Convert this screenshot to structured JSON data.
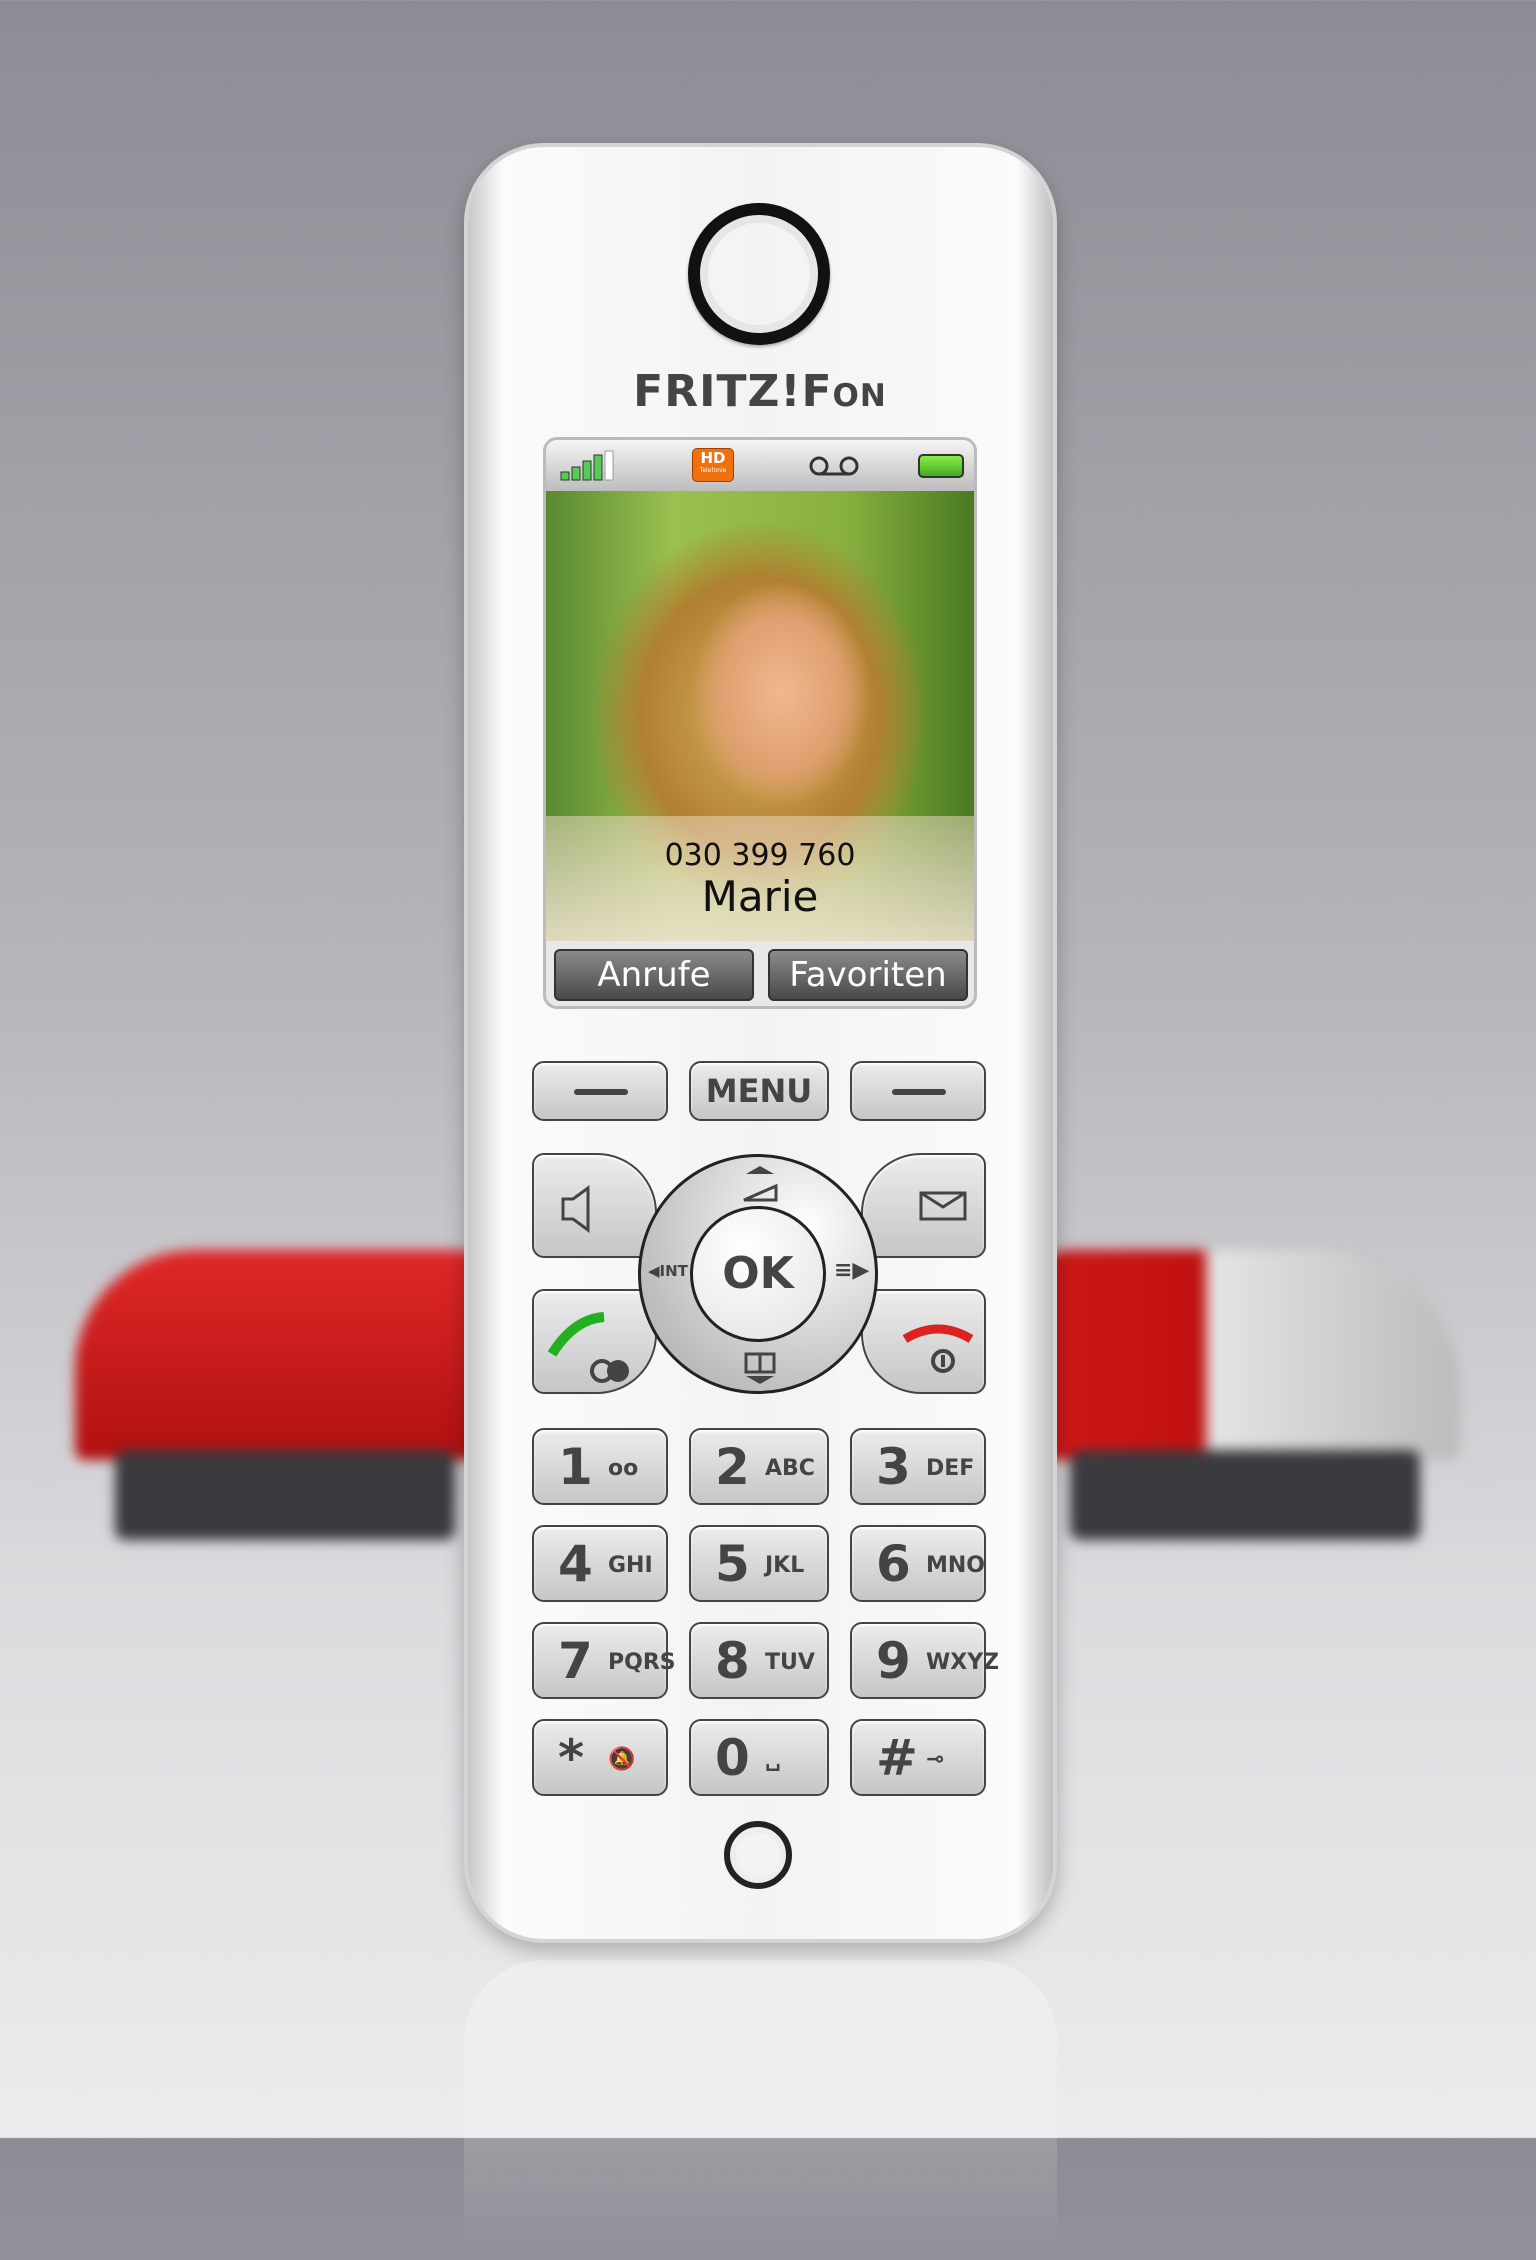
{
  "brand": {
    "logo": "FRITZ!Fon"
  },
  "status_bar": {
    "signal": "signal-strength-icon",
    "hd": "HD",
    "hd_sub": "Telefonie",
    "voicemail": "voicemail-icon",
    "battery": "battery-icon",
    "battery_level": 1.0
  },
  "contact": {
    "number": "030 399 760",
    "name": "Marie"
  },
  "softkeys": {
    "left": "Anrufe",
    "right": "Favoriten"
  },
  "controls": {
    "menu": "MENU",
    "ok": "OK",
    "int": "INT"
  },
  "keypad": [
    {
      "digit": "1",
      "letters": "oo"
    },
    {
      "digit": "2",
      "letters": "ABC"
    },
    {
      "digit": "3",
      "letters": "DEF"
    },
    {
      "digit": "4",
      "letters": "GHI"
    },
    {
      "digit": "5",
      "letters": "JKL"
    },
    {
      "digit": "6",
      "letters": "MNO"
    },
    {
      "digit": "7",
      "letters": "PQRS"
    },
    {
      "digit": "8",
      "letters": "TUV"
    },
    {
      "digit": "9",
      "letters": "WXYZ"
    },
    {
      "digit": "*",
      "letters": "🔕"
    },
    {
      "digit": "0",
      "letters": "␣"
    },
    {
      "digit": "#",
      "letters": "⊸"
    }
  ],
  "colors": {
    "call_green": "#22b022",
    "end_red": "#dd2020",
    "router_red": "#d01818"
  }
}
